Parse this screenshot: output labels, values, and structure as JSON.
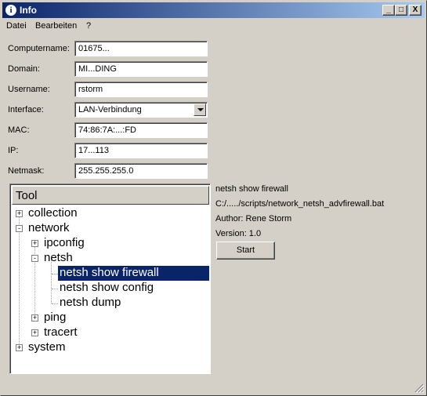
{
  "window": {
    "title": "Info",
    "icon": "info-icon",
    "controls": {
      "minimize": "_",
      "maximize": "□",
      "close": "X"
    }
  },
  "menu": [
    "Datei",
    "Bearbeiten",
    "?"
  ],
  "form": [
    {
      "label": "Computername:",
      "value": "01675..."
    },
    {
      "label": "Domain:",
      "value": "MI...DING"
    },
    {
      "label": "Username:",
      "value": "rstorm"
    },
    {
      "label": "Interface:",
      "value": "LAN-Verbindung"
    },
    {
      "label": "MAC:",
      "value": "74:86:7A:...:FD"
    },
    {
      "label": "IP:",
      "value": "17...113"
    },
    {
      "label": "Netmask:",
      "value": "255.255.255.0"
    }
  ],
  "tree": {
    "header": "Tool",
    "nodes": [
      {
        "label": "collection",
        "expander": "+"
      },
      {
        "label": "network",
        "expander": "-"
      },
      {
        "label": "ipconfig",
        "expander": "+"
      },
      {
        "label": "netsh",
        "expander": "-"
      },
      {
        "label": "netsh show firewall",
        "selected": true
      },
      {
        "label": "netsh show config"
      },
      {
        "label": "netsh dump"
      },
      {
        "label": "ping",
        "expander": "+"
      },
      {
        "label": "tracert",
        "expander": "+"
      },
      {
        "label": "system",
        "expander": "+"
      }
    ]
  },
  "details": {
    "command": "netsh show firewall",
    "path": "C:/...../scripts/network_netsh_advfirewall.bat",
    "author": "Author: Rene Storm",
    "version": "Version: 1.0",
    "start_label": "Start"
  },
  "colors": {
    "selection": "#0a246a",
    "titlebar": "#0a246a",
    "face": "#d4d0c8"
  }
}
